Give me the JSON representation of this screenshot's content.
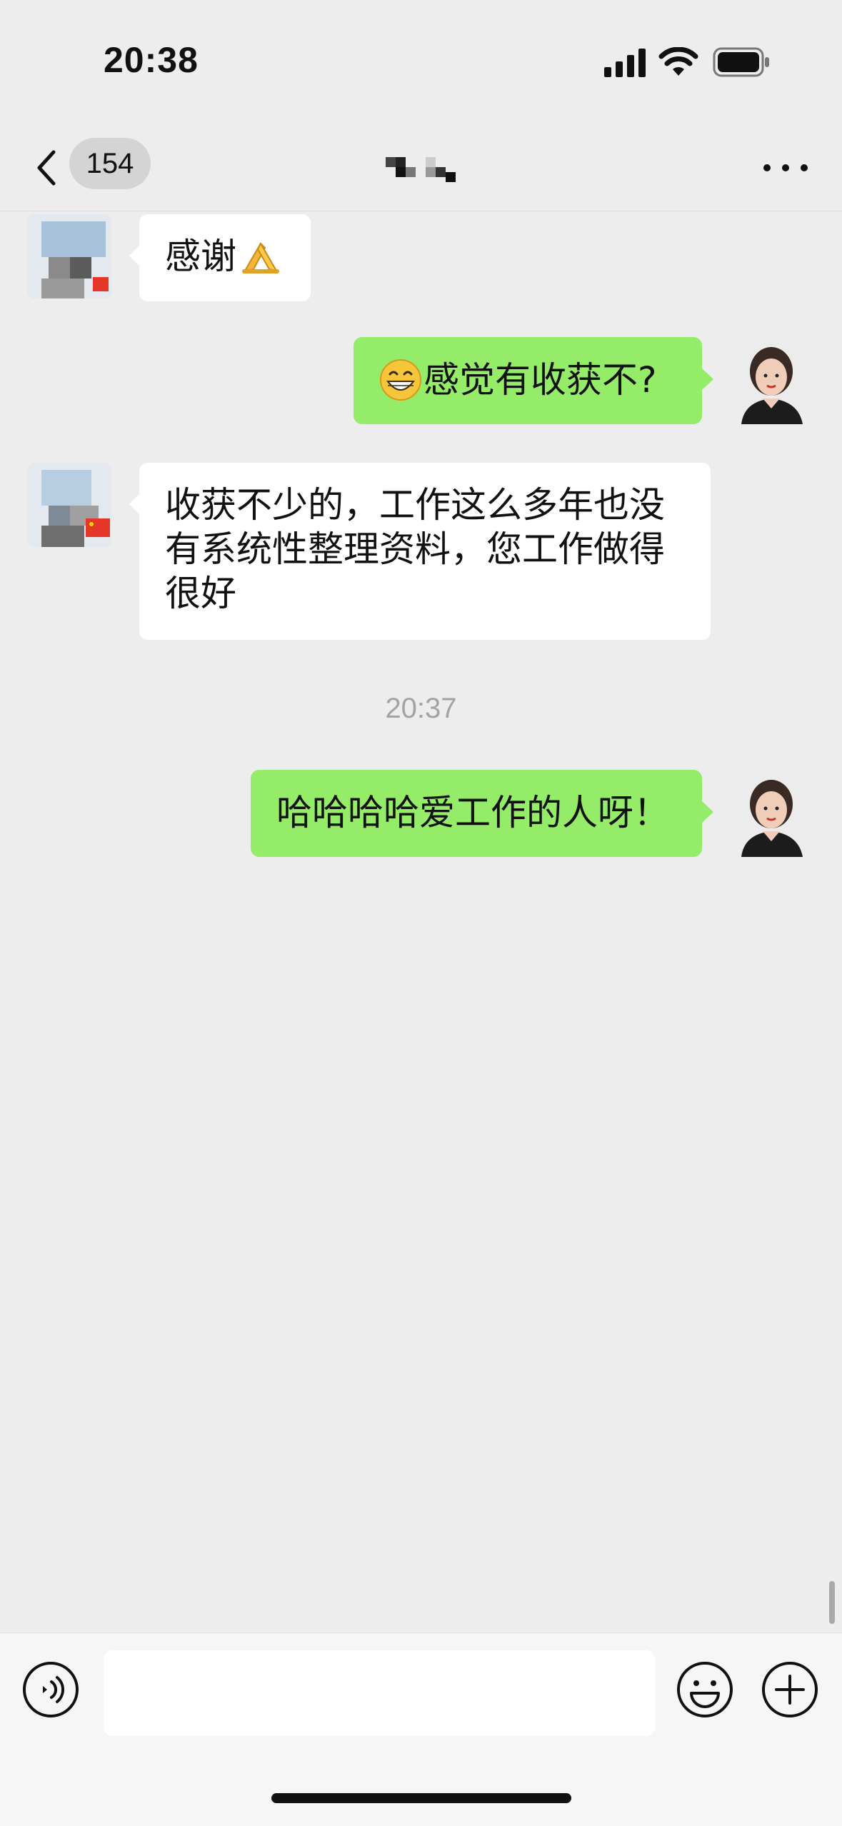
{
  "status_bar": {
    "time": "20:38",
    "icons": [
      "signal-icon",
      "wifi-icon",
      "battery-icon"
    ]
  },
  "nav": {
    "back_icon": "chevron-left-icon",
    "unread_count": "154",
    "more_icon": "ellipsis-icon"
  },
  "messages": [
    {
      "side": "incoming",
      "text": "感谢",
      "emoji_after": "pray-icon"
    },
    {
      "side": "outgoing",
      "emoji_before": "grin-icon",
      "text": "感觉有收获不?"
    },
    {
      "side": "incoming",
      "lines": [
        "收获不少的，工作这么多年也没",
        "有系统性整理资料，您工作做得",
        "很好"
      ]
    },
    {
      "side": "outgoing",
      "text": "哈哈哈哈爱工作的人呀！"
    }
  ],
  "timestamp": "20:37",
  "input_bar": {
    "voice_icon": "voice-icon",
    "input_value": "",
    "emoji_icon": "smiley-icon",
    "plus_icon": "plus-icon"
  },
  "colors": {
    "background": "#ededed",
    "outgoing_bubble": "#95ec69",
    "incoming_bubble": "#ffffff",
    "badge": "#d4d4d4"
  }
}
